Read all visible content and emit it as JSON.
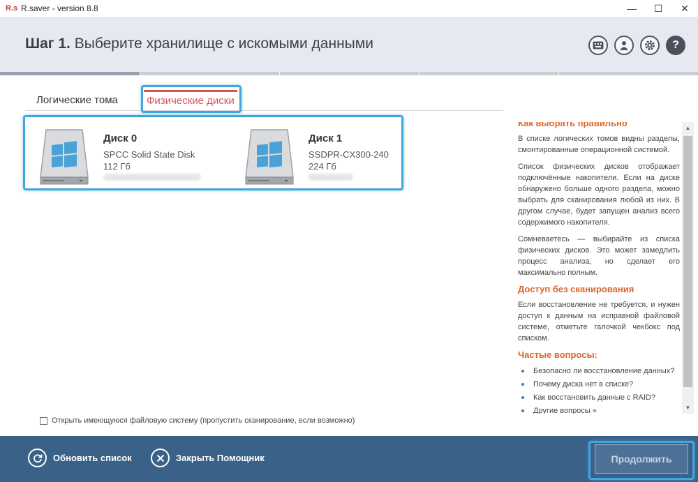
{
  "window": {
    "logo": "R.s",
    "title": "R.saver - version 8.8",
    "minimize": "—",
    "maximize": "☐",
    "close": "✕"
  },
  "header": {
    "step_label": "Шаг 1.",
    "step_title": "Выберите хранилище с искомыми данными",
    "icons": [
      "keyboard-icon",
      "user-icon",
      "gear-icon",
      "help-icon"
    ],
    "help_glyph": "?"
  },
  "progress": {
    "steps": 5,
    "current": 1
  },
  "tabs": {
    "logical": "Логические тома",
    "physical": "Физические диски",
    "active": "physical"
  },
  "disks": [
    {
      "name": "Диск 0",
      "model": "SPCC Solid State Disk",
      "size": "112 Гб"
    },
    {
      "name": "Диск 1",
      "model": "SSDPR-CX300-240",
      "size": "224 Гб"
    }
  ],
  "help": {
    "section1_title": "Как выбрать правильно",
    "p1": "В списке логических томов видны разделы, смонтированные операционной системой.",
    "p2": "Список физических дисков отображает подключённые накопители. Если на диске обнаружено больше одного раздела, можно выбрать для сканирования любой из них. В другом случае, будет запущен анализ всего содержимого накопителя.",
    "p3": "Сомневаетесь — выбирайте из списка физических дисков. Это может замедлить процесс анализа, но сделает его максимально полным.",
    "section2_title": "Доступ без сканирования",
    "p4": "Если восстановление не требуется, и нужен доступ к данным на исправной файловой системе, отметьте галочкой чекбокс под списком.",
    "section3_title": "Частые вопросы:",
    "faq": [
      "Безопасно ли восстановление данных?",
      "Почему диска нет в списке?",
      "Как восстановить данные с RAID?",
      "Другие вопросы »"
    ]
  },
  "checkbox": {
    "label": "Открыть имеющуюся файловую систему (пропустить сканирование, если возможно)",
    "checked": false
  },
  "footer": {
    "refresh": "Обновить список",
    "close_wizard": "Закрыть Помощник",
    "continue": "Продолжить"
  },
  "colors": {
    "accent": "#d9534f",
    "footer_bg": "#3a6188",
    "highlight": "#3fa7dc",
    "help_heading": "#d9662a"
  }
}
